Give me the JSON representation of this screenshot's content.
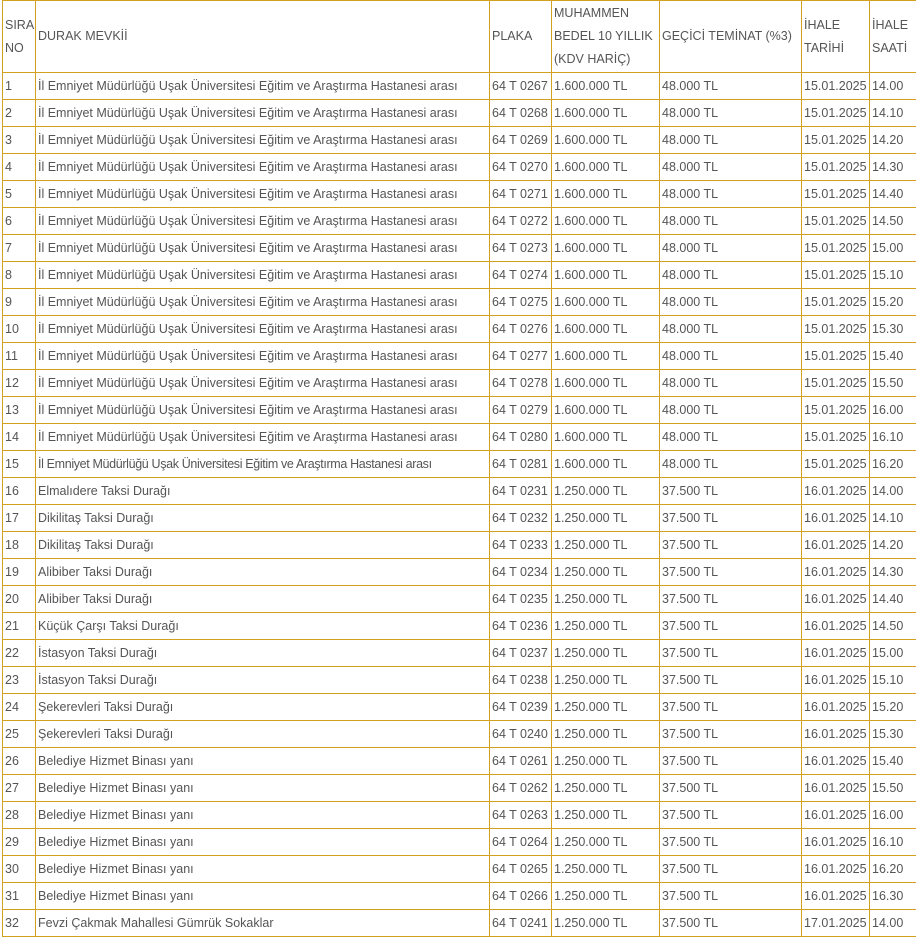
{
  "headers": [
    "SIRA NO",
    "DURAK MEVKİİ",
    "PLAKA",
    "MUHAMMEN BEDEL 10 YILLIK (KDV HARİÇ)",
    "GEÇİCİ TEMİNAT (%3)",
    "İHALE TARİHİ",
    "İHALE SAATİ"
  ],
  "rows": [
    [
      "1",
      "İl Emniyet Müdürlüğü Uşak Üniversitesi Eğitim ve Araştırma Hastanesi arası",
      "64 T 0267",
      "1.600.000 TL",
      "48.000 TL",
      "15.01.2025",
      "14.00"
    ],
    [
      "2",
      "İl Emniyet Müdürlüğü Uşak Üniversitesi Eğitim ve Araştırma Hastanesi arası",
      "64 T 0268",
      "1.600.000 TL",
      "48.000 TL",
      "15.01.2025",
      "14.10"
    ],
    [
      "3",
      "İl Emniyet Müdürlüğü Uşak Üniversitesi Eğitim ve Araştırma Hastanesi arası",
      "64 T 0269",
      "1.600.000 TL",
      "48.000 TL",
      "15.01.2025",
      "14.20"
    ],
    [
      "4",
      "İl Emniyet Müdürlüğü Uşak Üniversitesi Eğitim ve Araştırma Hastanesi arası",
      "64 T 0270",
      "1.600.000 TL",
      "48.000 TL",
      "15.01.2025",
      "14.30"
    ],
    [
      "5",
      "İl Emniyet Müdürlüğü Uşak Üniversitesi Eğitim ve Araştırma Hastanesi arası",
      "64 T 0271",
      "1.600.000 TL",
      "48.000 TL",
      "15.01.2025",
      "14.40"
    ],
    [
      "6",
      "İl Emniyet Müdürlüğü Uşak Üniversitesi Eğitim ve Araştırma Hastanesi arası",
      "64 T 0272",
      "1.600.000 TL",
      "48.000 TL",
      "15.01.2025",
      "14.50"
    ],
    [
      "7",
      "İl Emniyet Müdürlüğü Uşak Üniversitesi Eğitim ve Araştırma Hastanesi arası",
      "64 T 0273",
      "1.600.000 TL",
      "48.000 TL",
      "15.01.2025",
      "15.00"
    ],
    [
      "8",
      "İl Emniyet Müdürlüğü Uşak Üniversitesi Eğitim ve Araştırma Hastanesi arası",
      "64 T 0274",
      "1.600.000 TL",
      "48.000 TL",
      "15.01.2025",
      "15.10"
    ],
    [
      "9",
      "İl Emniyet Müdürlüğü Uşak Üniversitesi Eğitim ve Araştırma Hastanesi arası",
      "64 T 0275",
      "1.600.000 TL",
      "48.000 TL",
      "15.01.2025",
      "15.20"
    ],
    [
      "10",
      "İl Emniyet Müdürlüğü Uşak Üniversitesi Eğitim ve Araştırma Hastanesi arası",
      "64 T 0276",
      "1.600.000 TL",
      "48.000 TL",
      "15.01.2025",
      "15.30"
    ],
    [
      "11",
      "İl Emniyet Müdürlüğü Uşak Üniversitesi Eğitim ve Araştırma Hastanesi arası",
      "64 T 0277",
      "1.600.000 TL",
      "48.000 TL",
      "15.01.2025",
      "15.40"
    ],
    [
      "12",
      "İl Emniyet Müdürlüğü Uşak Üniversitesi Eğitim ve Araştırma Hastanesi arası",
      "64 T 0278",
      "1.600.000 TL",
      "48.000 TL",
      "15.01.2025",
      "15.50"
    ],
    [
      "13",
      "İl Emniyet Müdürlüğü Uşak Üniversitesi Eğitim ve Araştırma Hastanesi arası",
      "64 T 0279",
      "1.600.000 TL",
      "48.000 TL",
      "15.01.2025",
      "16.00"
    ],
    [
      "14",
      "İl Emniyet Müdürlüğü Uşak Üniversitesi Eğitim ve Araştırma Hastanesi arası",
      "64 T 0280",
      "1.600.000 TL",
      "48.000 TL",
      "15.01.2025",
      "16.10"
    ],
    [
      "15",
      " İl Emniyet Müdürlüğü Uşak Üniversitesi Eğitim ve Araştırma Hastanesi arası",
      " 64 T 0281",
      "1.600.000 TL",
      "48.000 TL",
      "15.01.2025",
      "16.20"
    ],
    [
      "16",
      "Elmalıdere Taksi Durağı",
      "64 T 0231",
      "1.250.000 TL",
      "37.500 TL",
      "16.01.2025",
      "14.00"
    ],
    [
      "17",
      "Dikilitaş Taksi Durağı",
      "64 T 0232",
      "1.250.000 TL",
      "37.500 TL",
      "16.01.2025",
      "14.10"
    ],
    [
      "18",
      "Dikilitaş Taksi Durağı",
      "64 T 0233",
      "1.250.000 TL",
      "37.500 TL",
      "16.01.2025",
      "14.20"
    ],
    [
      "19",
      "Alibiber Taksi Durağı",
      "64 T 0234",
      "1.250.000 TL",
      "37.500 TL",
      "16.01.2025",
      "14.30"
    ],
    [
      "20",
      "Alibiber Taksi Durağı",
      "64 T 0235",
      "1.250.000 TL",
      "37.500 TL",
      "16.01.2025",
      "14.40"
    ],
    [
      "21",
      "Küçük Çarşı Taksi Durağı",
      "64 T 0236",
      "1.250.000 TL",
      "37.500 TL",
      "16.01.2025",
      "14.50"
    ],
    [
      "22",
      "İstasyon Taksi Durağı",
      "64 T 0237",
      "1.250.000 TL",
      "37.500 TL",
      "16.01.2025",
      "15.00"
    ],
    [
      "23",
      "İstasyon Taksi Durağı",
      "64 T 0238",
      "1.250.000 TL",
      "37.500 TL",
      "16.01.2025",
      "15.10"
    ],
    [
      "24",
      "Şekerevleri Taksi Durağı",
      "64 T 0239",
      "1.250.000 TL",
      "37.500 TL",
      "16.01.2025",
      "15.20"
    ],
    [
      "25",
      "Şekerevleri Taksi Durağı",
      "64 T 0240",
      "1.250.000 TL",
      "37.500 TL",
      "16.01.2025",
      "15.30"
    ],
    [
      "26",
      "Belediye Hizmet Binası yanı",
      "64 T 0261",
      "1.250.000 TL",
      "37.500 TL",
      "16.01.2025",
      "15.40"
    ],
    [
      "27",
      "Belediye Hizmet Binası yanı",
      "64 T 0262",
      "1.250.000 TL",
      "37.500 TL",
      "16.01.2025",
      "15.50"
    ],
    [
      "28",
      "Belediye Hizmet Binası yanı",
      "64 T 0263",
      "1.250.000 TL",
      "37.500 TL",
      "16.01.2025",
      "16.00"
    ],
    [
      "29",
      "Belediye Hizmet Binası yanı",
      "64 T 0264",
      "1.250.000 TL",
      "37.500 TL",
      "16.01.2025",
      "16.10"
    ],
    [
      "30",
      "Belediye Hizmet Binası yanı",
      "64 T 0265",
      "1.250.000 TL",
      "37.500 TL",
      "16.01.2025",
      "16.20"
    ],
    [
      "31",
      "Belediye Hizmet Binası yanı",
      "64 T 0266",
      "1.250.000 TL",
      "37.500 TL",
      "16.01.2025",
      "16.30"
    ],
    [
      "32",
      "Fevzi Çakmak Mahallesi Gümrük Sokaklar",
      "64 T 0241",
      "1.250.000 TL",
      "37.500 TL",
      "17.01.2025",
      "14.00"
    ]
  ]
}
